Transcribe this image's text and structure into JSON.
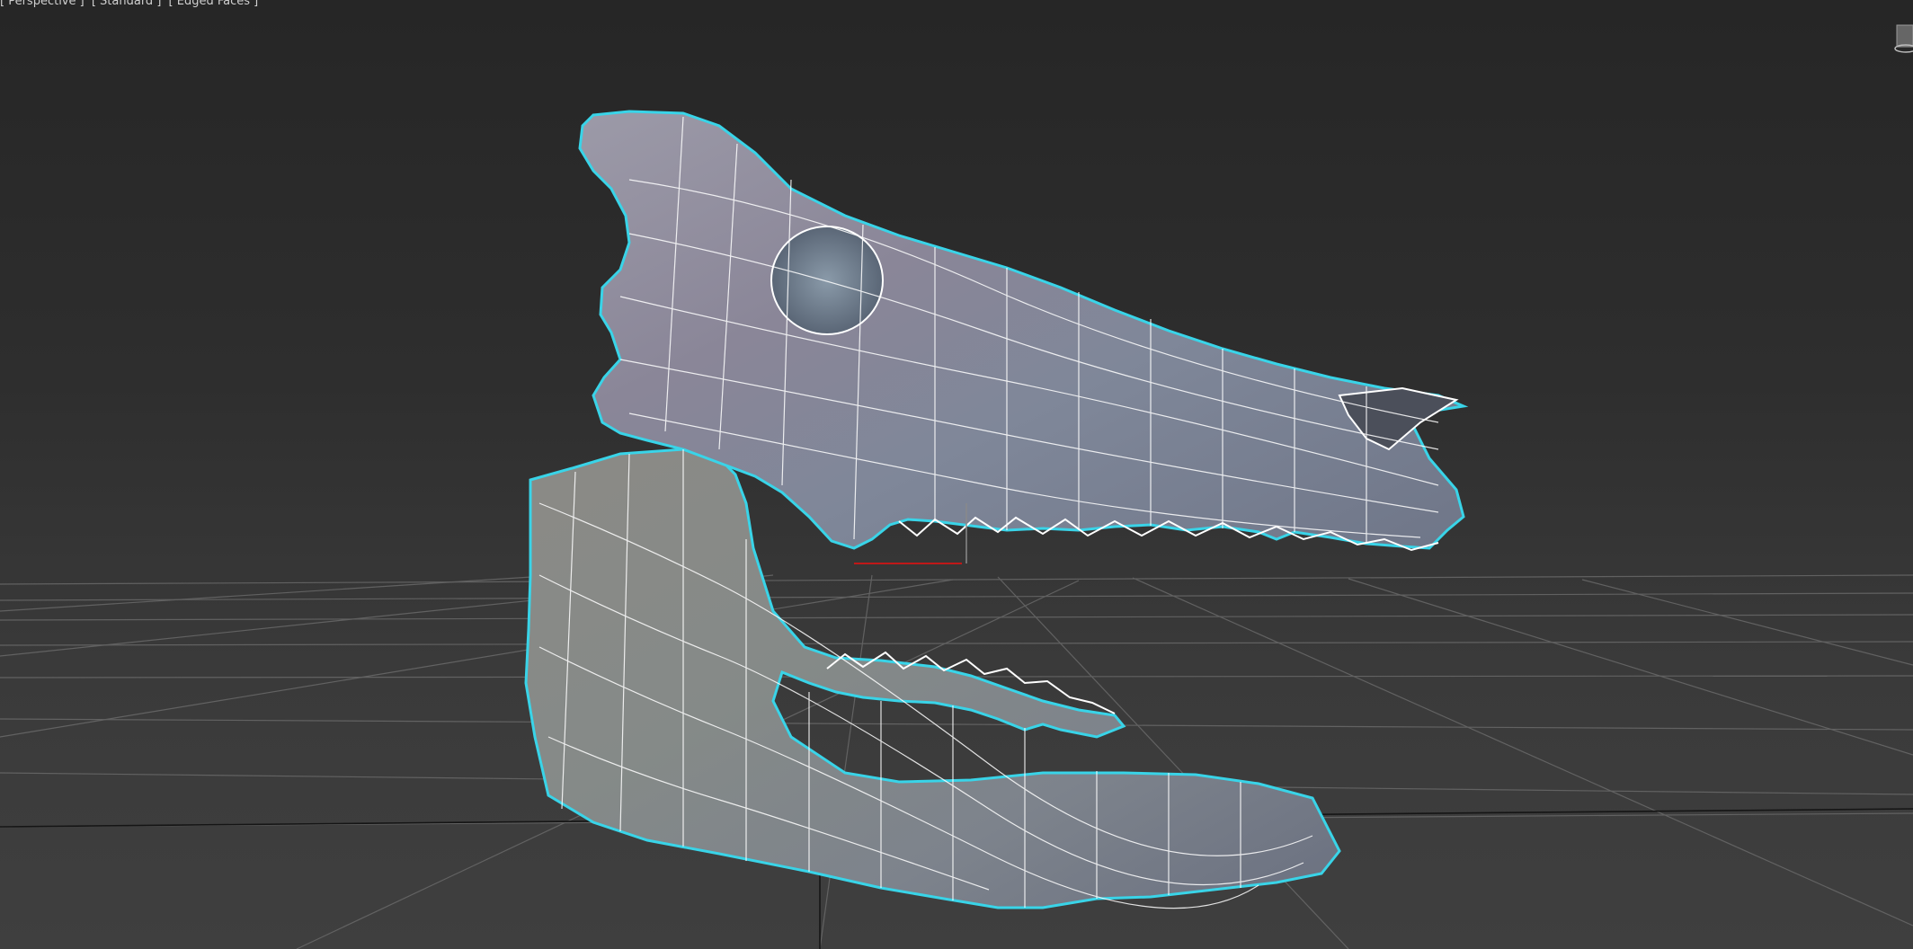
{
  "viewport": {
    "label_view": "[ Perspective ]",
    "label_shading": "[ Standard ]",
    "label_mode": "[ Edged Faces ]"
  },
  "scene": {
    "object": "skull-mesh",
    "selection_color": "#39d4e8",
    "wire_color": "#ffffff",
    "grid_color": "#6a6a6a",
    "axis_x_color": "#c01818"
  }
}
